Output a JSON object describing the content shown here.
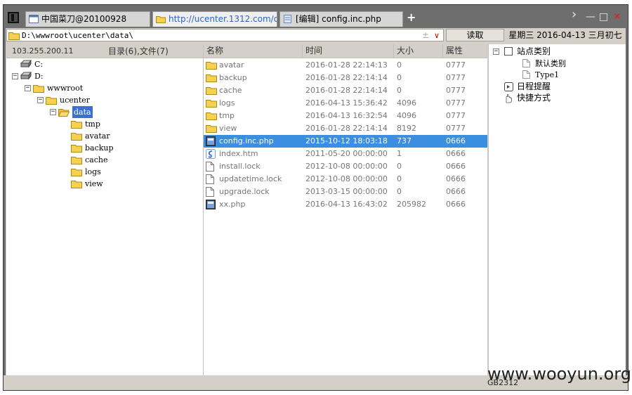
{
  "tabs": [
    {
      "label": "中国菜刀@20100928",
      "icon": "window-icon"
    },
    {
      "label": "http://ucenter.1312.com/dat...",
      "icon": "folder-icon"
    },
    {
      "label": "[编辑] config.inc.php",
      "icon": "document-icon"
    }
  ],
  "window_controls": {
    "next": "›",
    "minimize": "—",
    "maximize": "□",
    "close": "✕"
  },
  "add_tab": "+",
  "address": {
    "path": "D:\\wwwroot\\ucenter\\data\\",
    "plusminus": "±",
    "dropdown": "∨"
  },
  "read_button": "读取",
  "date_display": "星期三 2016-04-13 三月初七",
  "left_header": {
    "ip": "103.255.200.11",
    "counts": "目录(6),文件(7)"
  },
  "tree": [
    {
      "label": "C:",
      "icon": "drive-icon",
      "level": 1,
      "expander": ""
    },
    {
      "label": "D:",
      "icon": "drive-icon",
      "level": 1,
      "expander": "−"
    },
    {
      "label": "wwwroot",
      "icon": "folder-icon",
      "level": 2,
      "expander": "−"
    },
    {
      "label": "ucenter",
      "icon": "folder-icon",
      "level": 3,
      "expander": "−"
    },
    {
      "label": "data",
      "icon": "folder-open-icon",
      "level": 4,
      "expander": "−",
      "selected": true
    },
    {
      "label": "tmp",
      "icon": "folder-icon",
      "level": 5,
      "expander": ""
    },
    {
      "label": "avatar",
      "icon": "folder-icon",
      "level": 5,
      "expander": ""
    },
    {
      "label": "backup",
      "icon": "folder-icon",
      "level": 5,
      "expander": ""
    },
    {
      "label": "cache",
      "icon": "folder-icon",
      "level": 5,
      "expander": ""
    },
    {
      "label": "logs",
      "icon": "folder-icon",
      "level": 5,
      "expander": ""
    },
    {
      "label": "view",
      "icon": "folder-icon",
      "level": 5,
      "expander": ""
    }
  ],
  "file_columns": {
    "name": "名称",
    "time": "时间",
    "size": "大小",
    "attr": "属性"
  },
  "files": [
    {
      "name": "avatar",
      "time": "2016-01-28 22:14:13",
      "size": "0",
      "attr": "0777",
      "icon": "folder-icon"
    },
    {
      "name": "backup",
      "time": "2016-01-28 22:14:14",
      "size": "0",
      "attr": "0777",
      "icon": "folder-icon"
    },
    {
      "name": "cache",
      "time": "2016-01-28 22:14:14",
      "size": "0",
      "attr": "0777",
      "icon": "folder-icon"
    },
    {
      "name": "logs",
      "time": "2016-04-13 15:36:42",
      "size": "4096",
      "attr": "0777",
      "icon": "folder-icon"
    },
    {
      "name": "tmp",
      "time": "2016-04-13 16:32:54",
      "size": "4096",
      "attr": "0777",
      "icon": "folder-icon"
    },
    {
      "name": "view",
      "time": "2016-01-28 22:14:14",
      "size": "8192",
      "attr": "0777",
      "icon": "folder-icon"
    },
    {
      "name": "config.inc.php",
      "time": "2015-10-12 18:03:18",
      "size": "737",
      "attr": "0666",
      "icon": "php-file-icon",
      "selected": true
    },
    {
      "name": "index.htm",
      "time": "2011-05-20 00:00:00",
      "size": "1",
      "attr": "0666",
      "icon": "html-file-icon"
    },
    {
      "name": "install.lock",
      "time": "2012-10-08 00:00:00",
      "size": "0",
      "attr": "0666",
      "icon": "file-icon"
    },
    {
      "name": "updatetime.lock",
      "time": "2012-10-08 00:00:00",
      "size": "0",
      "attr": "0666",
      "icon": "file-icon"
    },
    {
      "name": "upgrade.lock",
      "time": "2013-03-15 00:00:00",
      "size": "0",
      "attr": "0666",
      "icon": "file-icon"
    },
    {
      "name": "xx.php",
      "time": "2016-04-13 16:43:02",
      "size": "205982",
      "attr": "0666",
      "icon": "php-file-icon"
    }
  ],
  "right_tree": [
    {
      "label": "站点类别",
      "icon": "checkbox-icon",
      "level": 1,
      "expander": "−"
    },
    {
      "label": "默认类别",
      "icon": "page-icon",
      "level": 2,
      "expander": ""
    },
    {
      "label": "Type1",
      "icon": "page-icon",
      "level": 2,
      "expander": ""
    },
    {
      "label": "日程提醒",
      "icon": "calendar-icon",
      "level": 1,
      "expander": ""
    },
    {
      "label": "快捷方式",
      "icon": "shortcut-icon",
      "level": 1,
      "expander": ""
    }
  ],
  "status": {
    "encoding": "GB2312"
  },
  "watermark": "www.wooyun.org",
  "colors": {
    "selection": "#3b8ee0",
    "tab_active_text": "#2a66c8",
    "close": "#e02020"
  }
}
